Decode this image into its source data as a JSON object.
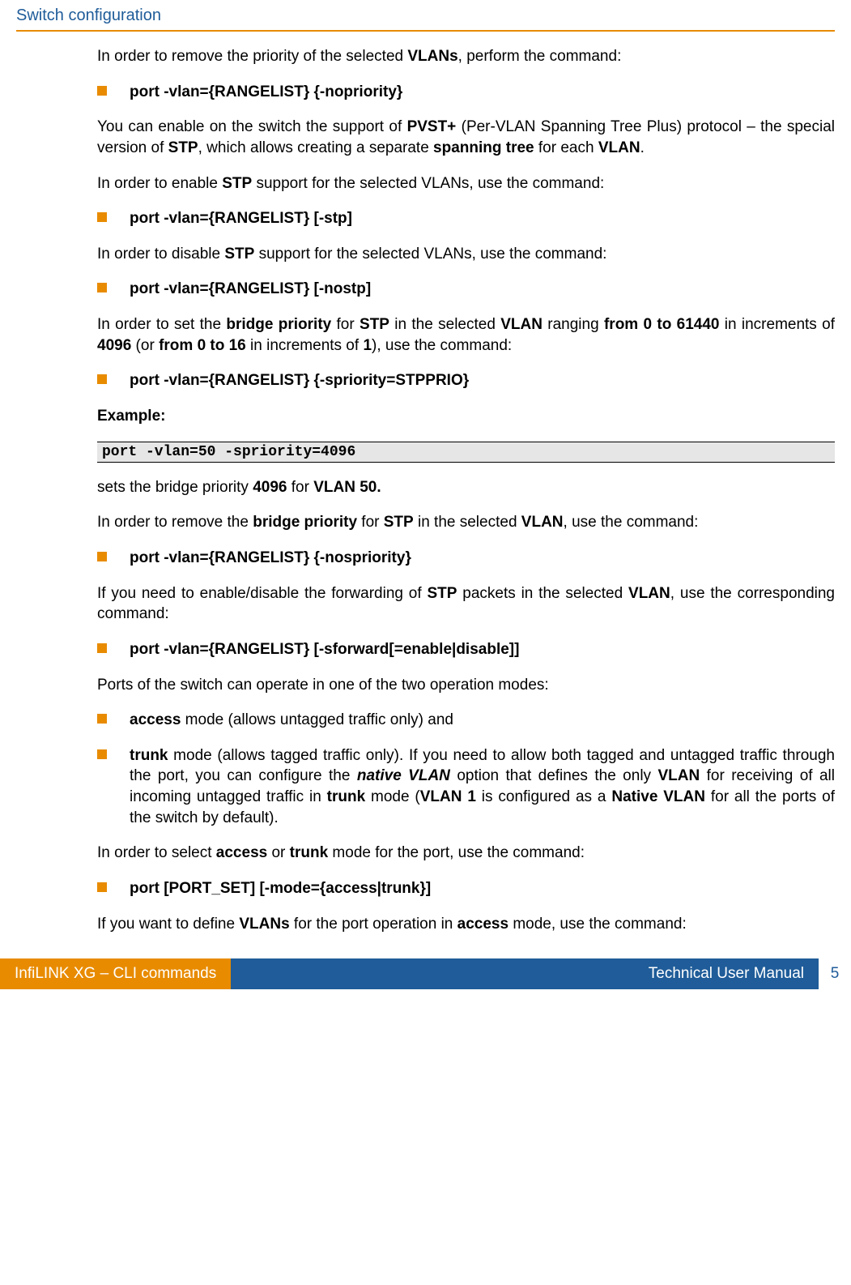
{
  "header": {
    "title": "Switch configuration"
  },
  "body": {
    "p1_a": "In order to remove the priority of the selected ",
    "p1_b": "VLANs",
    "p1_c": ", perform the command:",
    "c1": "port -vlan={RANGELIST} {-nopriority}",
    "p2_a": "You can enable on the switch the support of ",
    "p2_b": "PVST+",
    "p2_c": " (Per-VLAN Spanning Tree Plus) protocol – the special version of ",
    "p2_d": "STP",
    "p2_e": ", which allows creating a separate ",
    "p2_f": "spanning tree",
    "p2_g": " for each ",
    "p2_h": "VLAN",
    "p2_i": ".",
    "p3_a": "In order to enable ",
    "p3_b": "STP",
    "p3_c": " support for the selected VLANs, use the command:",
    "c2": "port -vlan={RANGELIST} [-stp]",
    "p4_a": "In order to disable ",
    "p4_b": "STP",
    "p4_c": " support for the selected VLANs, use the command:",
    "c3": "port -vlan={RANGELIST} [-nostp]",
    "p5_a": "In order to set the ",
    "p5_b": "bridge priority",
    "p5_c": " for ",
    "p5_d": "STP",
    "p5_e": " in the selected ",
    "p5_f": "VLAN",
    "p5_g": " ranging ",
    "p5_h": "from 0 to 61440",
    "p5_i": " in increments of ",
    "p5_j": "4096",
    "p5_k": " (or ",
    "p5_l": "from 0 to 16",
    "p5_m": " in increments of ",
    "p5_n": "1",
    "p5_o": "), use the command:",
    "c4": "port -vlan={RANGELIST} {-spriority=STPPRIO}",
    "example_label": "Example:",
    "code1": "port -vlan=50 -spriority=4096",
    "p6_a": "sets the bridge priority ",
    "p6_b": "4096",
    "p6_c": " for ",
    "p6_d": "VLAN 50.",
    "p7_a": "In order to remove the ",
    "p7_b": "bridge priority",
    "p7_c": " for ",
    "p7_d": "STP",
    "p7_e": " in the selected ",
    "p7_f": "VLAN",
    "p7_g": ", use the command:",
    "c5": "port -vlan={RANGELIST} {-nospriority}",
    "p8_a": "If you need to enable/disable the forwarding of ",
    "p8_b": "STP",
    "p8_c": " packets in the selected ",
    "p8_d": "VLAN",
    "p8_e": ", use the corresponding command:",
    "c6": "port -vlan={RANGELIST} [-sforward[=enable|disable]]",
    "p9": "Ports of the switch can operate in one of the two operation modes:",
    "b1_a": "access",
    "b1_b": " mode (allows untagged traffic only) and",
    "b2_a": "trunk",
    "b2_b": " mode (allows tagged traffic only). If you need to allow both tagged and untagged traffic through the port, you can configure the ",
    "b2_c": "native VLAN",
    "b2_d": " option that defines the only ",
    "b2_e": "VLAN",
    "b2_f": " for receiving of all incoming untagged traffic in ",
    "b2_g": "trunk",
    "b2_h": " mode (",
    "b2_i": "VLAN 1",
    "b2_j": " is configured as a ",
    "b2_k": "Native VLAN",
    "b2_l": " for all the ports of the switch by default).",
    "p10_a": "In order to select ",
    "p10_b": "access",
    "p10_c": " or ",
    "p10_d": "trunk",
    "p10_e": " mode for the port, use the command:",
    "c7": "port [PORT_SET] [-mode={access|trunk}]",
    "p11_a": "If you want to define ",
    "p11_b": "VLANs",
    "p11_c": " for the port operation in ",
    "p11_d": "access",
    "p11_e": " mode, use the command:"
  },
  "footer": {
    "left": "InfiLINK XG – CLI commands",
    "right": "Technical User Manual",
    "page": "5"
  }
}
